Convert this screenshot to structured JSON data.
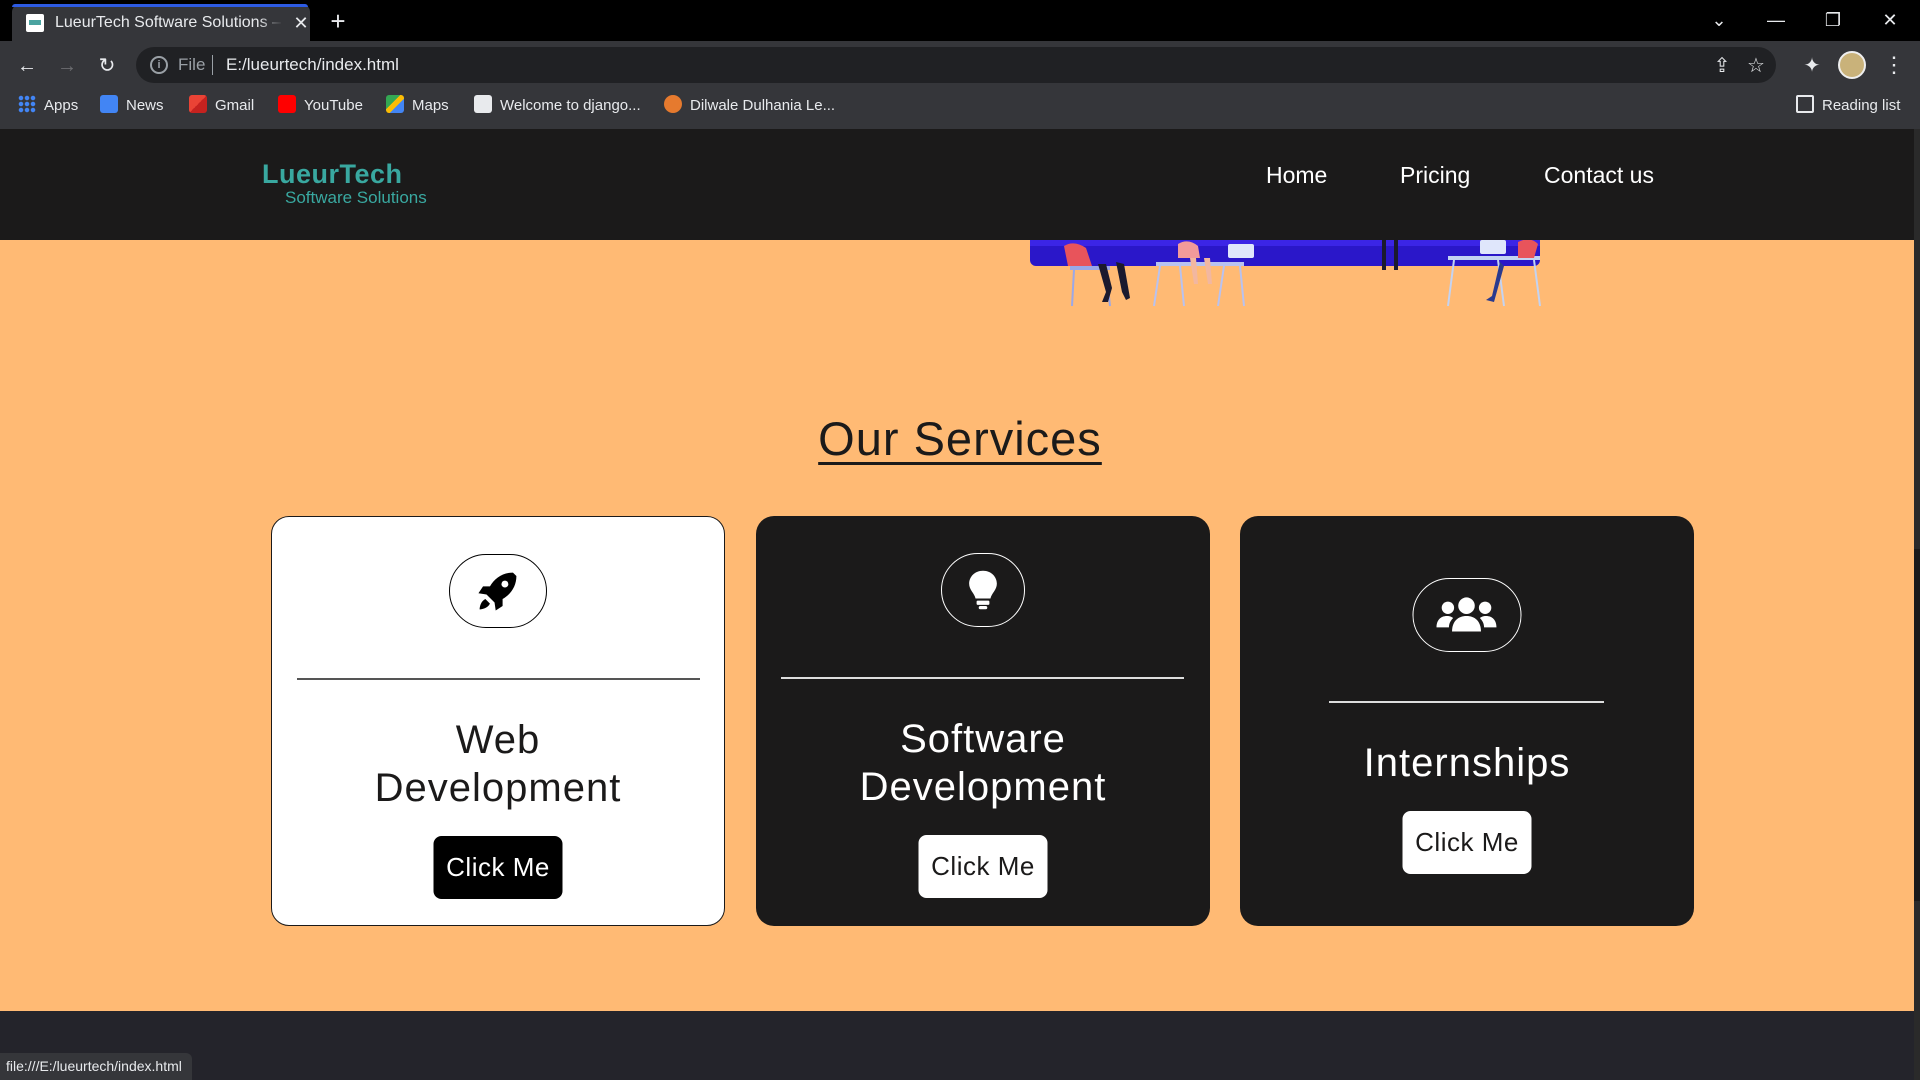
{
  "browser": {
    "tab_title": "LueurTech Software Solutions – Index",
    "tab_close": "✕",
    "new_tab": "+",
    "window_controls": {
      "tabsearch": "⌄",
      "minimize": "—",
      "restore": "❐",
      "close": "✕"
    },
    "nav": {
      "back": "←",
      "forward": "→",
      "reload": "↻"
    },
    "address": {
      "scheme": "File",
      "url": "E:/lueurtech/index.html"
    },
    "omnibox_icons": {
      "share": "⇪",
      "bookmark_star": "☆",
      "extensions": "✦"
    },
    "menu": "⋮",
    "bookmarks": [
      {
        "label": "Apps",
        "icon": "apps-grid-icon",
        "color": "#4285f4"
      },
      {
        "label": "News",
        "icon": "google-news-icon",
        "color": "#4285f4"
      },
      {
        "label": "Gmail",
        "icon": "gmail-icon",
        "color": "#ea4335"
      },
      {
        "label": "YouTube",
        "icon": "youtube-icon",
        "color": "#ff0000"
      },
      {
        "label": "Maps",
        "icon": "maps-icon",
        "color": "#34a853"
      },
      {
        "label": "Welcome to django...",
        "icon": "django-icon",
        "color": "#e8eaed"
      },
      {
        "label": "Dilwale Dulhania Le...",
        "icon": "movie-icon",
        "color": "#e67a2e"
      }
    ],
    "reading_list": "Reading list",
    "status_url": "file:///E:/lueurtech/index.html"
  },
  "site": {
    "logo": {
      "line1": "LueurTech",
      "line2": "Software Solutions",
      "color": "#39a8a0"
    },
    "nav": [
      "Home",
      "Pricing",
      "Contact us"
    ],
    "background": "#ffba74",
    "dark": "#1b1a1a"
  },
  "services": {
    "heading": "Our Services",
    "cards": [
      {
        "title_line1": "Web",
        "title_line2": "Development",
        "button": "Click Me",
        "icon": "rocket-icon",
        "theme": "light"
      },
      {
        "title_line1": "Software",
        "title_line2": "Development",
        "button": "Click Me",
        "icon": "lightbulb-icon",
        "theme": "dark"
      },
      {
        "title_line1": "Internships",
        "title_line2": "",
        "button": "Click Me",
        "icon": "users-icon",
        "theme": "dark"
      }
    ]
  }
}
